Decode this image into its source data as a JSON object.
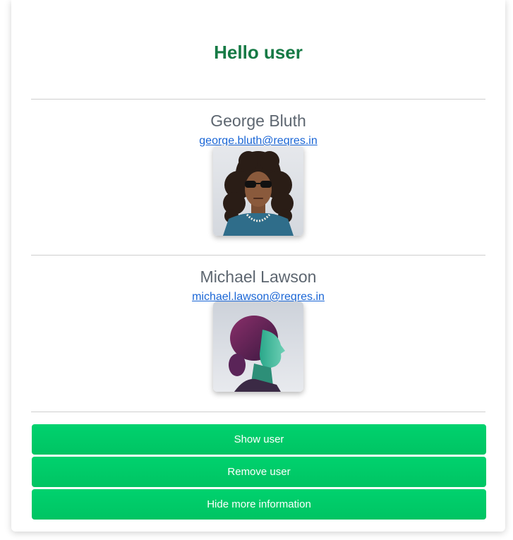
{
  "header": {
    "title": "Hello user"
  },
  "users": [
    {
      "name": "George Bluth",
      "email": "george.bluth@reqres.in",
      "avatar_alt": "George Bluth avatar"
    },
    {
      "name": "Michael Lawson",
      "email": "michael.lawson@reqres.in",
      "avatar_alt": "Michael Lawson avatar"
    }
  ],
  "actions": {
    "show_label": "Show user",
    "remove_label": "Remove user",
    "hide_label": "Hide more information"
  },
  "colors": {
    "title": "#167a45",
    "button": "#00cc6a",
    "link": "#1a66d6",
    "name": "#5d6670"
  }
}
